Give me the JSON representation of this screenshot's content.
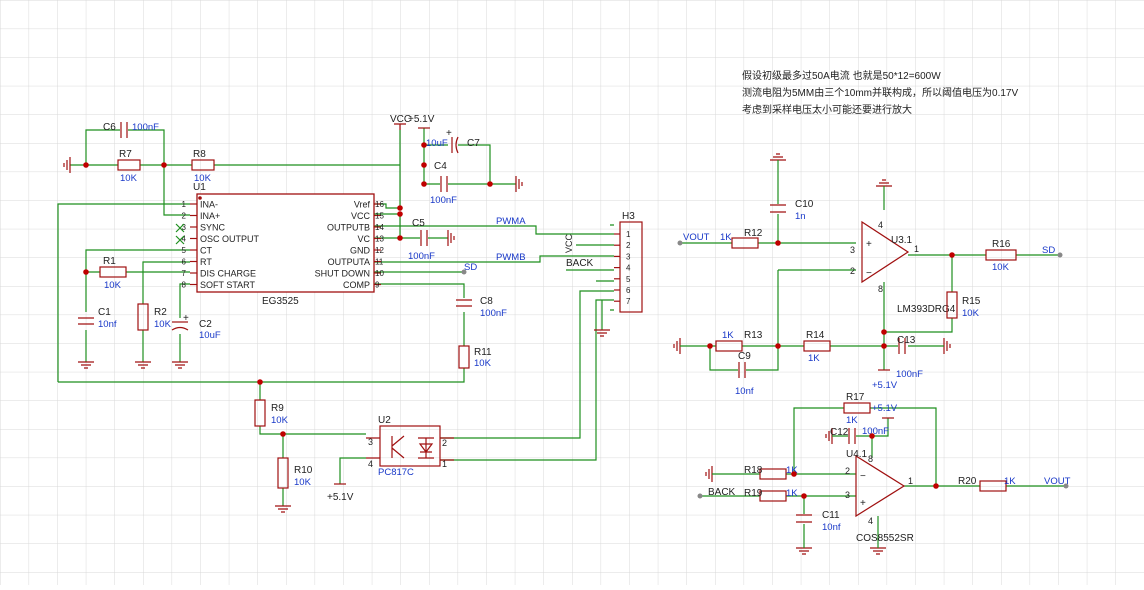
{
  "notes": [
    "假设初级最多过50A电流 也就是50*12=600W",
    "测流电阻为5MM由三个10mm并联构成，所以阈值电压为0.17V",
    "考虑到采样电压太小可能还要进行放大"
  ],
  "ic_eg3525": {
    "ref": "U1",
    "part": "EG3525",
    "pins_left": [
      {
        "n": "1",
        "name": "INA-"
      },
      {
        "n": "2",
        "name": "INA+"
      },
      {
        "n": "3",
        "name": "SYNC"
      },
      {
        "n": "4",
        "name": "OSC OUTPUT"
      },
      {
        "n": "5",
        "name": "CT"
      },
      {
        "n": "6",
        "name": "RT"
      },
      {
        "n": "7",
        "name": "DIS CHARGE"
      },
      {
        "n": "8",
        "name": "SOFT START"
      }
    ],
    "pins_right": [
      {
        "n": "16",
        "name": "Vref"
      },
      {
        "n": "15",
        "name": "VCC"
      },
      {
        "n": "14",
        "name": "OUTPUTB"
      },
      {
        "n": "13",
        "name": "VC"
      },
      {
        "n": "12",
        "name": "GND"
      },
      {
        "n": "11",
        "name": "OUTPUTA"
      },
      {
        "n": "10",
        "name": "SHUT DOWN"
      },
      {
        "n": "9",
        "name": "COMP"
      }
    ]
  },
  "components": {
    "c6": {
      "ref": "C6",
      "value": "100nF"
    },
    "r7": {
      "ref": "R7",
      "value": "10K"
    },
    "r8": {
      "ref": "R8",
      "value": "10K"
    },
    "r1": {
      "ref": "R1",
      "value": "10K"
    },
    "c1": {
      "ref": "C1",
      "value": "10nf"
    },
    "r2": {
      "ref": "R2",
      "value": "10K"
    },
    "c2": {
      "ref": "C2",
      "value": "10uF"
    },
    "c7": {
      "ref": "C7",
      "value": "10uF"
    },
    "c4": {
      "ref": "C4",
      "value": "100nF"
    },
    "c5": {
      "ref": "C5",
      "value": "100nF"
    },
    "c8": {
      "ref": "C8",
      "value": "100nF"
    },
    "r11": {
      "ref": "R11",
      "value": "10K"
    },
    "r9": {
      "ref": "R9",
      "value": "10K"
    },
    "r10": {
      "ref": "R10",
      "value": "10K"
    },
    "u2": {
      "ref": "U2",
      "value": "PC817C"
    },
    "h3": {
      "ref": "H3"
    },
    "r12": {
      "ref": "R12",
      "value": "1K"
    },
    "c10": {
      "ref": "C10",
      "value": "1n"
    },
    "u3": {
      "ref": "U3.1",
      "value": "LM393DRG4"
    },
    "r16": {
      "ref": "R16",
      "value": "10K"
    },
    "r15": {
      "ref": "R15",
      "value": "10K"
    },
    "r13": {
      "ref": "R13",
      "value": "1K"
    },
    "r14": {
      "ref": "R14",
      "value": "1K"
    },
    "c9": {
      "ref": "C9",
      "value": "10nf"
    },
    "c13": {
      "ref": "C13",
      "value": "100nF"
    },
    "r17": {
      "ref": "R17",
      "value": "1K"
    },
    "c12": {
      "ref": "C12",
      "value": "100nF"
    },
    "u4": {
      "ref": "U4.1",
      "value": "COS8552SR"
    },
    "r18": {
      "ref": "R18",
      "value": "1K"
    },
    "r19": {
      "ref": "R19",
      "value": "1K"
    },
    "c11": {
      "ref": "C11",
      "value": "10nf"
    },
    "r20": {
      "ref": "R20",
      "value": "1K"
    }
  },
  "nets": {
    "vcc": "VCC",
    "v51": "+5.1V",
    "pwma": "PWMA",
    "pwmb": "PWMB",
    "sd": "SD",
    "back": "BACK",
    "vout": "VOUT"
  },
  "header_pins": [
    "1",
    "2",
    "3",
    "4",
    "5",
    "6",
    "7"
  ],
  "opamp_pins": {
    "plus": "3",
    "minus": "2",
    "out": "1",
    "v8": "8",
    "v4": "4"
  },
  "opto_pins": {
    "p1": "1",
    "p2": "2",
    "p3": "3",
    "p4": "4"
  },
  "signs": {
    "plus": "+",
    "minus": "−"
  }
}
